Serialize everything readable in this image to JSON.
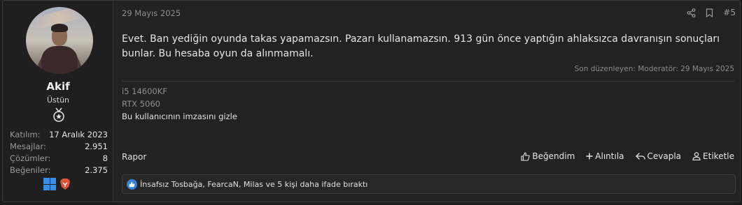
{
  "user": {
    "name": "Akif",
    "title": "Üstün",
    "stats": [
      {
        "label": "Katılım:",
        "value": "17 Aralık 2023"
      },
      {
        "label": "Mesajlar:",
        "value": "2.951"
      },
      {
        "label": "Çözümler:",
        "value": "8"
      },
      {
        "label": "Beğeniler:",
        "value": "2.375"
      }
    ],
    "badge_icons": [
      "windows-icon",
      "brave-icon"
    ]
  },
  "post": {
    "date": "29 Mayıs 2025",
    "number": "#5",
    "message": "Evet. Ban yediğin oyunda takas yapamazsın. Pazarı kullanamazsın. 913 gün önce yaptığın ahlaksızca davranışın sonuçları bunlar. Bu hesaba oyun da alınmamalı.",
    "edited": "Son düzenleyen: Moderatör: 29 Mayıs 2025",
    "signature": {
      "lines": [
        "i5 14600KF",
        "RTX 5060"
      ],
      "toggle": "Bu kullanıcının imzasını gizle"
    },
    "report": "Rapor",
    "actions": {
      "like": "Beğendim",
      "quote": "Alıntıla",
      "reply": "Cevapla",
      "tag": "Etiketle"
    },
    "reactions": "İnsafsız Tosbağa, FearcaN, Milas ve 5 kişi daha ifade bıraktı"
  },
  "colors": {
    "background": "#1c1c1c",
    "panel": "#222222",
    "accent_like": "#3b82d6",
    "windows": "#3b8ee6",
    "brave": "#e0533a"
  }
}
